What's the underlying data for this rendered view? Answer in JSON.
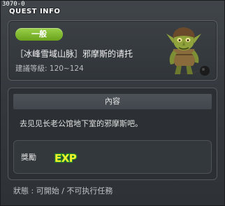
{
  "window": {
    "quest_id": "3070-0",
    "title": "QUEST INFO"
  },
  "quest": {
    "category": "一般",
    "name": "［冰峰雪域山脉］邪摩斯的请托",
    "level_label": "建議等級:",
    "level_range": "120~124",
    "npc_icon": "goblin-npc-portrait"
  },
  "content": {
    "section_title": "內容",
    "description": "去见见长老公馆地下室的邪摩斯吧。"
  },
  "reward": {
    "label": "獎勵",
    "exp_icon_text": "EXP"
  },
  "status": {
    "text": "狀態 : 可開始 / 不可执行任務"
  },
  "colors": {
    "category_badge": "#7fbb2e",
    "exp_yellow": "#f2ef2a",
    "exp_green": "#1f8a2c",
    "panel_border": "#5b6166"
  }
}
